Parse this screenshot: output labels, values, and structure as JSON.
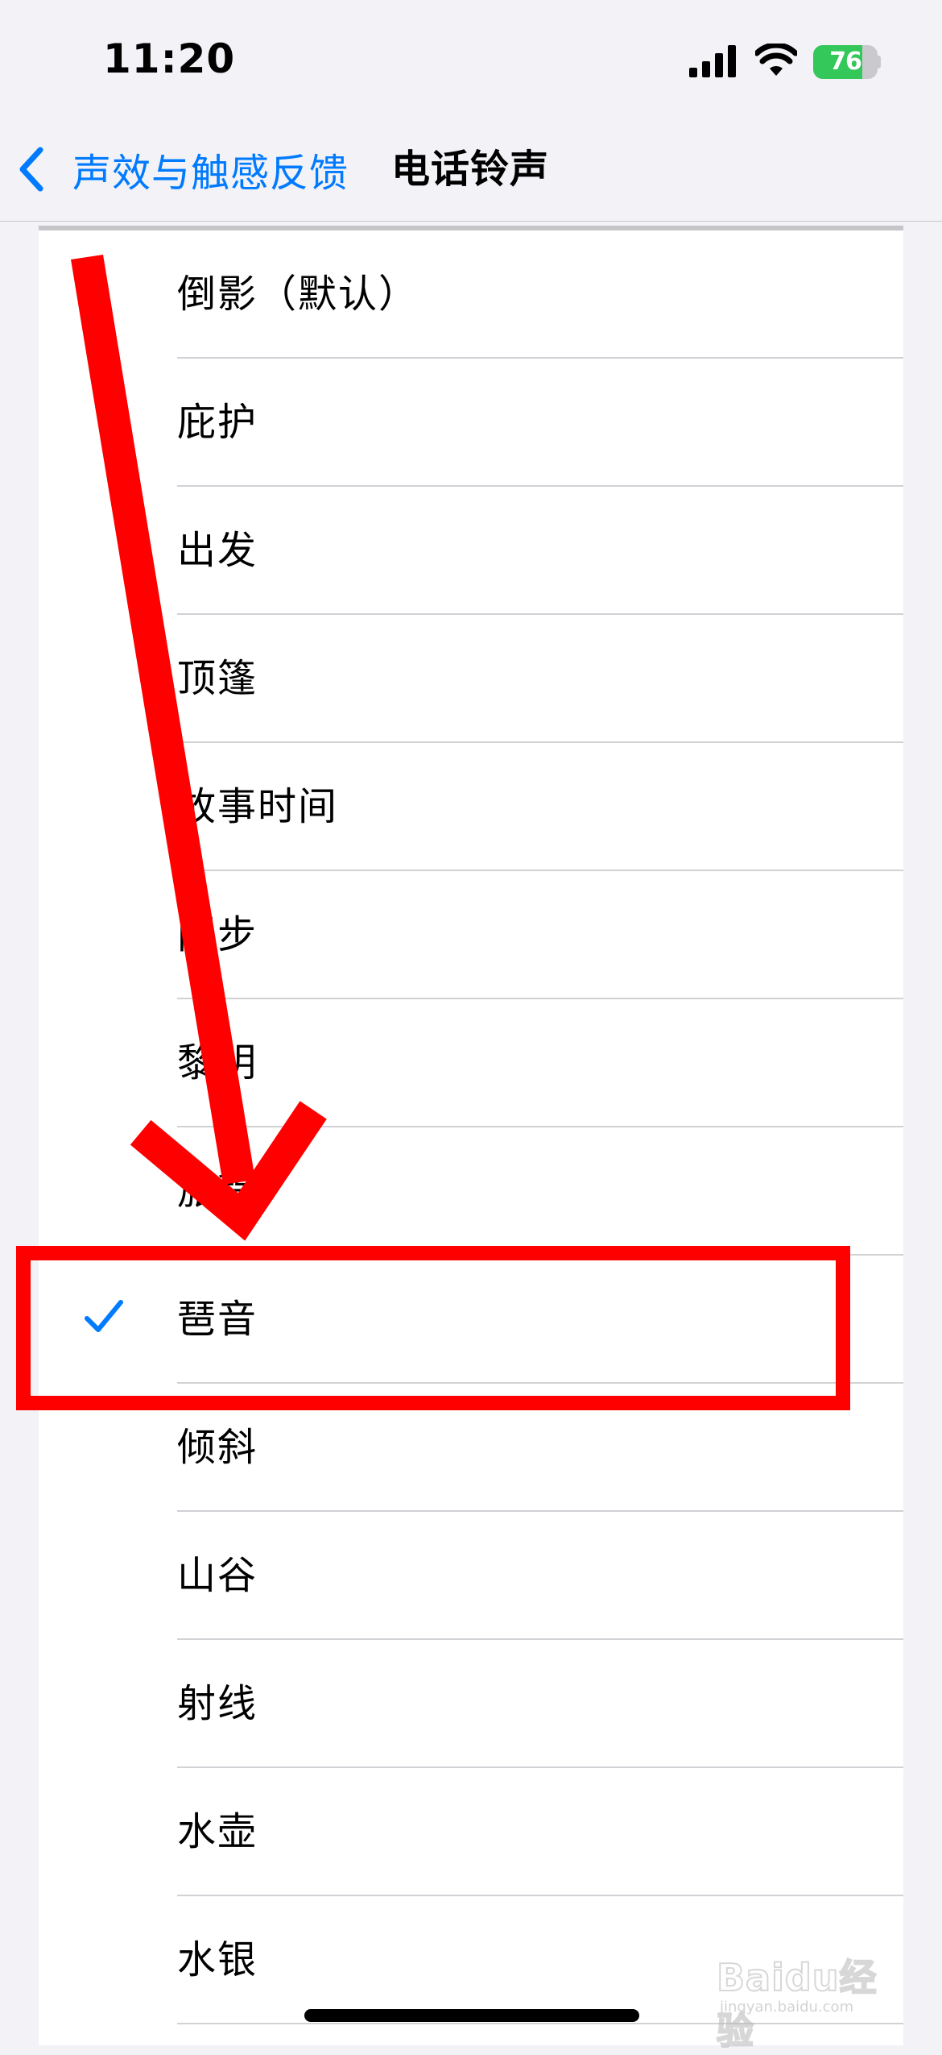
{
  "status_bar": {
    "time": "11:20",
    "battery_percent": 76,
    "battery_label": "76",
    "battery_charging": true,
    "icons": [
      "signal-icon",
      "wifi-icon",
      "battery-icon"
    ]
  },
  "nav": {
    "back_label": "声效与触感反馈",
    "title": "电话铃声"
  },
  "ringtones": [
    {
      "label": "倒影（默认）",
      "selected": false
    },
    {
      "label": "庇护",
      "selected": false
    },
    {
      "label": "出发",
      "selected": false
    },
    {
      "label": "顶篷",
      "selected": false
    },
    {
      "label": "故事时间",
      "selected": false
    },
    {
      "label": "同步",
      "selected": false
    },
    {
      "label": "黎明",
      "selected": false
    },
    {
      "label": "旅程",
      "selected": false
    },
    {
      "label": "琶音",
      "selected": true
    },
    {
      "label": "倾斜",
      "selected": false
    },
    {
      "label": "山谷",
      "selected": false
    },
    {
      "label": "射线",
      "selected": false
    },
    {
      "label": "水壶",
      "selected": false
    },
    {
      "label": "水银",
      "selected": false
    }
  ],
  "colors": {
    "accent": "#007aff",
    "annotation": "#ff0000",
    "battery_green": "#34c759",
    "background": "#f2f2f7"
  },
  "watermark": {
    "main": "Baidu经验",
    "sub": "jingyan.baidu.com"
  }
}
